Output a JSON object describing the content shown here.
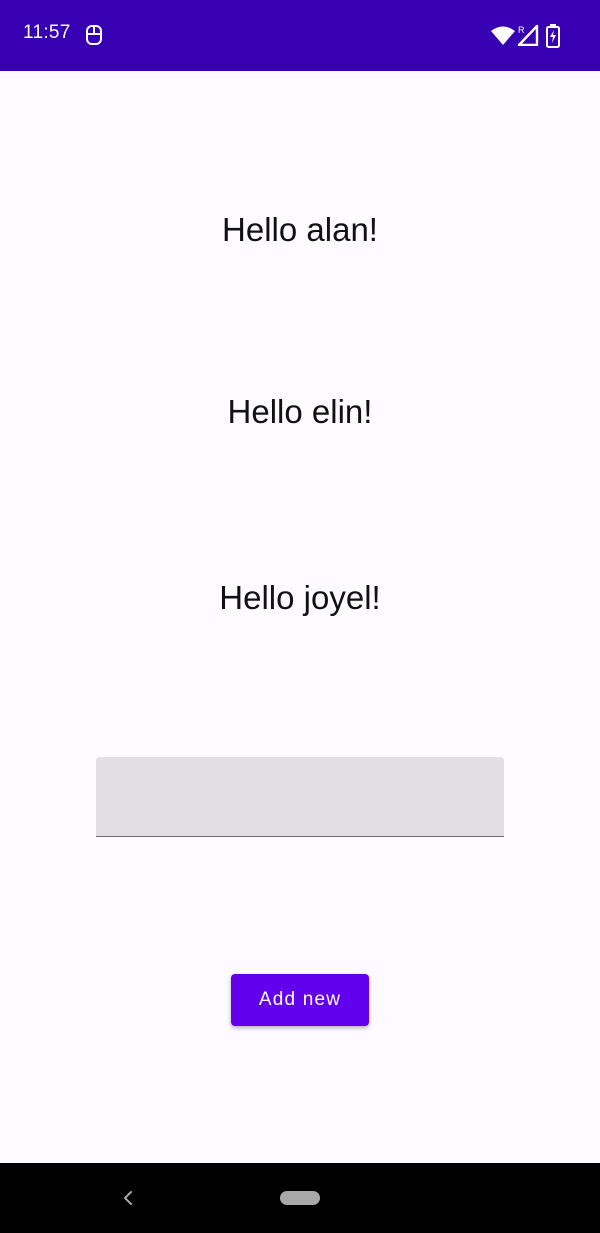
{
  "status_bar": {
    "time": "11:57",
    "background_color": "#3700b3",
    "icons": [
      "app-notification-icon",
      "wifi-icon",
      "signal-icon",
      "battery-charging-icon"
    ]
  },
  "greetings": [
    "Hello alan!",
    "Hello elin!",
    "Hello joyel!"
  ],
  "input": {
    "value": "",
    "placeholder": ""
  },
  "add_button": {
    "label": "Add new",
    "color": "#6200ee"
  },
  "nav_bar": {
    "icons": [
      "back-icon",
      "home-pill"
    ]
  }
}
